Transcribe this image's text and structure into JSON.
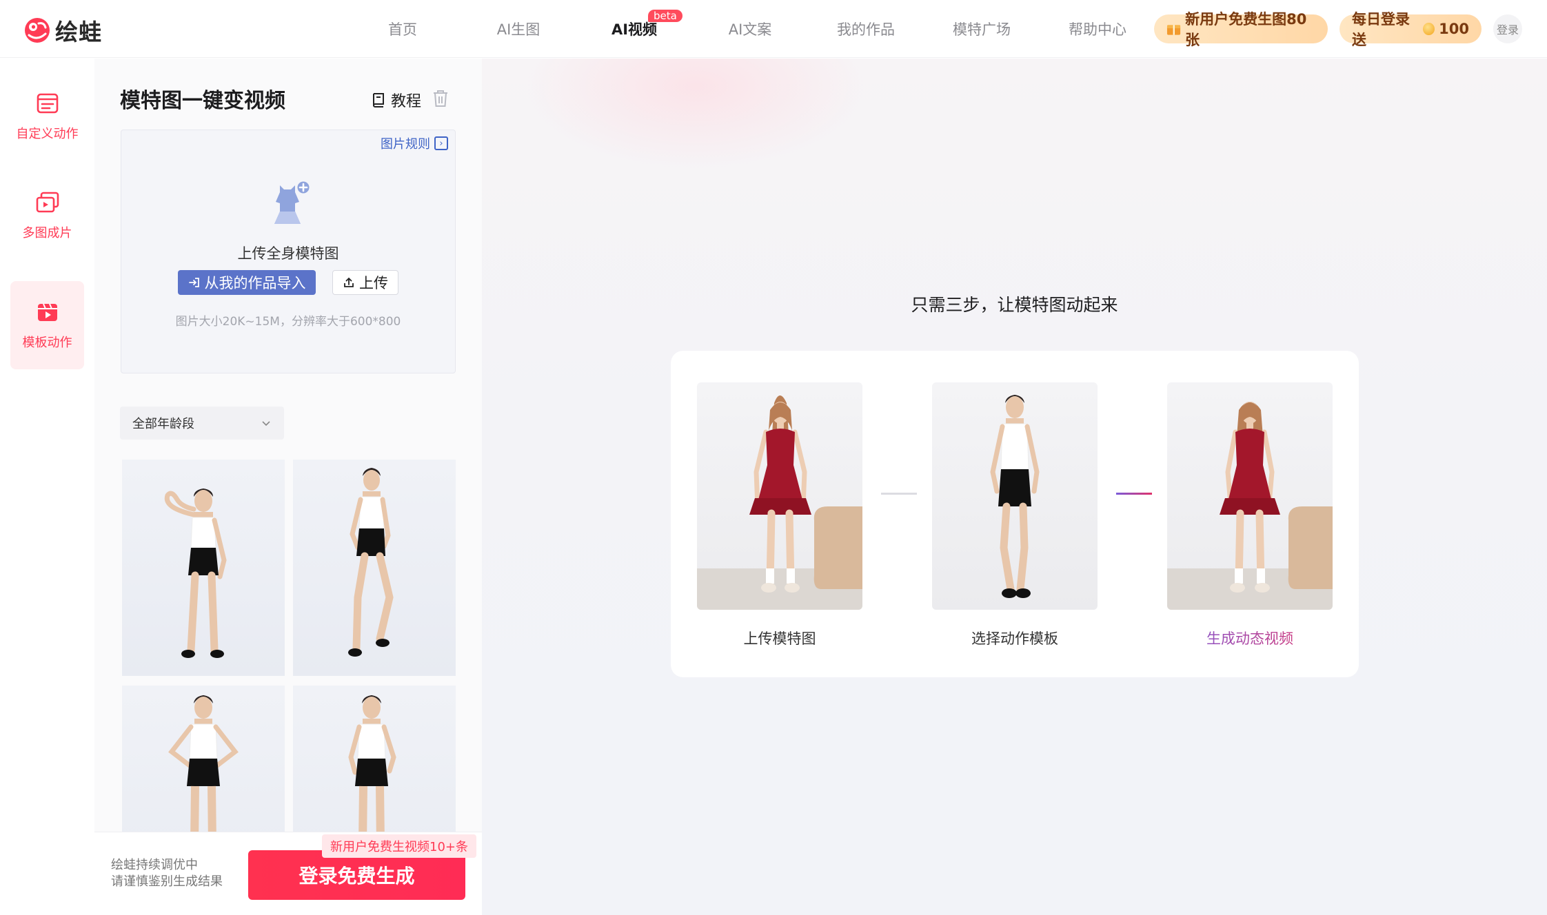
{
  "brand": {
    "name": "绘蛙",
    "accent": "#ff3b55"
  },
  "nav": {
    "items": [
      {
        "label": "首页",
        "active": false
      },
      {
        "label": "AI生图",
        "active": false
      },
      {
        "label": "AI视频",
        "active": true,
        "badge": "beta"
      },
      {
        "label": "AI文案",
        "active": false
      },
      {
        "label": "我的作品",
        "active": false
      },
      {
        "label": "模特广场",
        "active": false
      },
      {
        "label": "帮助中心",
        "active": false
      }
    ],
    "promo_new_user": "新用户免费生图80张",
    "promo_daily_label": "每日登录送",
    "promo_daily_amount": "100",
    "login": "登录"
  },
  "rail": {
    "items": [
      {
        "label": "自定义动作",
        "icon": "edit-list-icon",
        "active": false
      },
      {
        "label": "多图成片",
        "icon": "multi-image-icon",
        "active": false
      },
      {
        "label": "模板动作",
        "icon": "video-clapper-icon",
        "active": true
      }
    ]
  },
  "panel": {
    "title": "模特图一键变视频",
    "tutorial": "教程",
    "upload": {
      "rule_link": "图片规则",
      "label": "上传全身模特图",
      "import_button": "从我的作品导入",
      "upload_button": "上传",
      "hint": "图片大小20K~15M，分辨率大于600*800"
    },
    "age_filter": {
      "selected": "全部年龄段"
    },
    "templates": [
      {
        "pose": "hand-on-head"
      },
      {
        "pose": "walking"
      },
      {
        "pose": "hands-on-hips"
      },
      {
        "pose": "hands-relaxed"
      }
    ]
  },
  "bottom": {
    "disclaimer_line1": "绘蛙持续调优中",
    "disclaimer_line2": "请谨慎鉴别生成结果",
    "new_user_tag": "新用户免费生视频10+条",
    "login_button": "登录免费生成"
  },
  "main": {
    "title": "只需三步，让模特图动起来",
    "steps": [
      {
        "label": "上传模特图"
      },
      {
        "label": "选择动作模板"
      },
      {
        "label": "生成动态视频"
      }
    ]
  }
}
